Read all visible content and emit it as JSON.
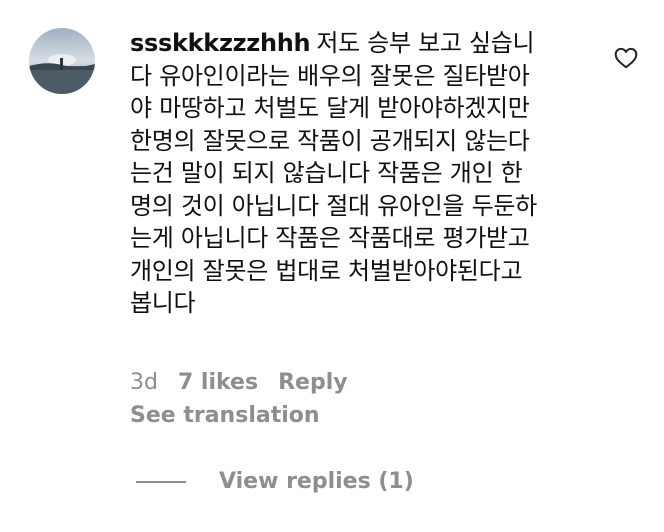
{
  "comment": {
    "username": "ssskkkzzzhhh",
    "lines": [
      "저도 승부 보고 싶습니",
      "다 유아인이라는 배우의 잘못은 질타받아",
      "야 마땅하고 처벌도 달게 받아야하겠지만",
      "한명의 잘못으로 작품이 공개되지 않는다",
      "는건 말이 되지 않습니다 작품은 개인 한",
      "명의 것이 아닙니다 절대 유아인을 두둔하",
      "는게 아닙니다 작품은 작품대로 평가받고",
      "개인의 잘못은 법대로 처벌받아야된다고",
      "봅니다"
    ],
    "time": "3d",
    "likes": "7 likes",
    "reply_label": "Reply",
    "see_translation": "See translation",
    "view_replies": "View replies (1)"
  },
  "icons": {
    "avatar": "profile-photo",
    "like": "heart-outline-icon"
  },
  "colors": {
    "text": "#111111",
    "secondary": "#8e8e8e",
    "background": "#ffffff"
  }
}
